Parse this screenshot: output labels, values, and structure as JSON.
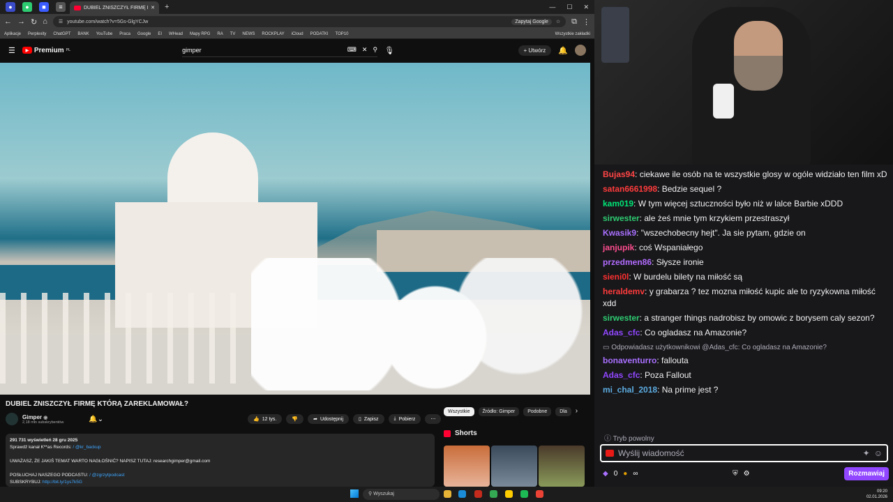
{
  "browser": {
    "tab_title": "DUBIEL ZNISZCZYŁ FIRMĘ KTÓ",
    "url": "youtube.com/watch?v=5Gs-GlgYCJw",
    "ask_google": "Zapytaj Google",
    "bookmarks": [
      "Aplikacje",
      "Perplexity",
      "ChatGPT",
      "BANK",
      "YouTube",
      "Praca",
      "Google",
      "EI",
      "WHead",
      "Mapy RPG",
      "RA",
      "TV",
      "NEWS",
      "ROCKPLAY",
      "iCloud",
      "PODATKI",
      "TOP10"
    ],
    "all_bookmarks": "Wszystkie zakładki"
  },
  "youtube": {
    "premium_label": "Premium",
    "premium_sup": "PL",
    "search_query": "gimper",
    "create_label": "Utwórz",
    "video_title": "DUBIEL ZNISZCZYŁ FIRMĘ KTÓRĄ ZAREKLAMOWAŁ?",
    "channel_name": "Gimper",
    "subscribers": "2,18 mln subskrybentów",
    "likes": "12 tys.",
    "share": "Udostępnij",
    "save": "Zapisz",
    "download": "Pobierz",
    "views_date": "291 731 wyświetleń  28 gru 2025",
    "desc_line2": "Sprawdź kanał K**as Records:",
    "desc_line2_link": "/ @kr_backup",
    "desc_line3": "UWAŻASZ, ŻE JAKIŚ TEMAT WARTO NAGŁOŚNIĆ? NAPISZ TUTAJ:",
    "desc_email": "researchgimper@gmail.com",
    "desc_line4": "POSŁUCHAJ NASZEGO PODCASTU:",
    "desc_line4_link": "/ @zgrzytpodcast",
    "desc_line5": "SUBSKRYBUJ:",
    "desc_line5_link": "http://bit.ly/1ys7k5G",
    "chips": [
      "Wszystkie",
      "Źródło: Gimper",
      "Podobne",
      "Dla"
    ],
    "shorts_label": "Shorts"
  },
  "chat": {
    "messages": [
      {
        "user": "Bujas94",
        "color": "#ff4545",
        "text": ": ciekawe ile osób na te wszystkie glosy w ogóle widziało ten film xD"
      },
      {
        "user": "satan6661998",
        "color": "#ff3b3b",
        "text": ": Bedzie sequel ?"
      },
      {
        "user": "kam019",
        "color": "#00e676",
        "text": ": W tym więcej sztuczności było niż w lalce Barbie xDDD"
      },
      {
        "user": "sirwester",
        "color": "#2ecc71",
        "text": ": ale żeś mnie tym krzykiem przestraszył"
      },
      {
        "user": "Kwasik9",
        "color": "#a970ff",
        "text": ": \"wszechobecny hejt\". Ja sie pytam, gdzie on"
      },
      {
        "user": "janjupik",
        "color": "#ff4d8d",
        "text": ": coś Wspaniałego"
      },
      {
        "user": "przedmen86",
        "color": "#b26cff",
        "text": ": Słysze ironie"
      },
      {
        "user": "sieni0l",
        "color": "#ff3030",
        "text": ": W burdelu bilety na miłość są"
      },
      {
        "user": "heraldemv",
        "color": "#ff3b3b",
        "text": ": y grabarza ? tez mozna miłość kupic ale to ryzykowna miłość xdd"
      },
      {
        "user": "sirwester",
        "color": "#2ecc71",
        "text": ": a stranger things nadrobisz by omowic z borysem caly sezon?"
      },
      {
        "user": "Adas_cfc",
        "color": "#9147ff",
        "text": ": Co ogladasz na Amazonie?"
      }
    ],
    "reply_note": "Odpowiadasz użytkownikowi @Adas_cfc: Co ogladasz na Amazonie?",
    "messages2": [
      {
        "user": "bonaventurro",
        "color": "#a970ff",
        "text": ": fallouta"
      },
      {
        "user": "Adas_cfc",
        "color": "#9147ff",
        "text": ": Poza Fallout"
      },
      {
        "user": "mi_chal_2018",
        "color": "#5dade2",
        "text": ": Na prime jest ?"
      }
    ],
    "slow_mode": "Tryb powolny",
    "input_placeholder": "Wyślij wiadomość",
    "points": "0",
    "infinity": "∞",
    "send_label": "Rozmawiaj"
  },
  "taskbar": {
    "search_placeholder": "Wyszukaj",
    "time": "09:20",
    "date": "02.01.2026"
  }
}
